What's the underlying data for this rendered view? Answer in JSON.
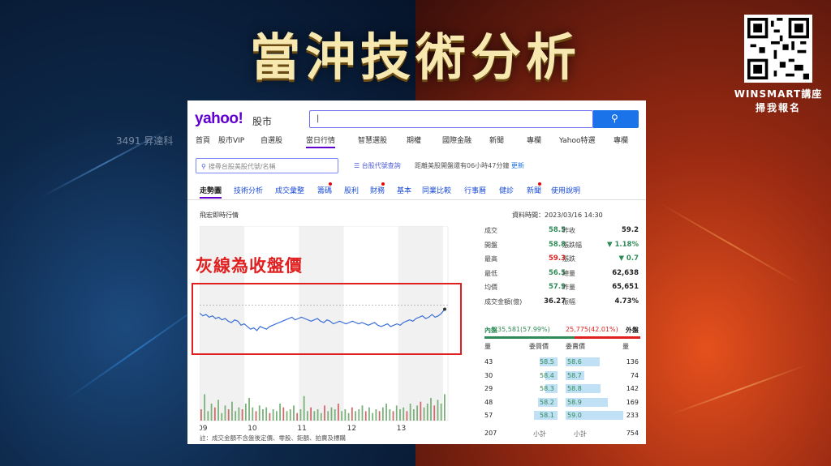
{
  "headline": "當沖技術分析",
  "qr_caption": {
    "line1": "WINSMART講座",
    "line2": "掃我報名"
  },
  "behind_text": "3491 昇達科",
  "annotation": "灰線為收盤價",
  "yahoo": {
    "logo": "yahoo!",
    "logo_sub": "股市",
    "search_button_icon": "search-icon",
    "nav": [
      "首頁",
      "股市VIP",
      "自選股",
      "當日行情",
      "智慧選股",
      "期權",
      "國際金融",
      "新聞",
      "專欄",
      "Yahoo特選",
      "專欄"
    ],
    "nav_active_index": 3,
    "filter_placeholder": "搜尋台股美股代號/名稱",
    "tool_link": "台股代號查詢",
    "market_notice": "距離美股開盤還有06小時47分鐘",
    "market_update": "更新",
    "subtabs": [
      "走勢圖",
      "技術分析",
      "成交彙整",
      "籌碼",
      "股利",
      "財務",
      "基本",
      "同業比較",
      "行事曆",
      "健診",
      "新聞",
      "使用說明"
    ],
    "subtab_active_index": 0,
    "subtab_dots": [
      3,
      5,
      10
    ],
    "section_label": "飛宏即時行情",
    "timestamp": "資料時間：2023/03/16 14:30"
  },
  "chart_data": {
    "type": "line",
    "x_ticks": [
      "09",
      "10",
      "11",
      "12",
      "13"
    ],
    "y_ticks": [
      "65.10",
      "63.92",
      "62.74",
      "61.56",
      "60.38",
      "59.20",
      "58.02",
      "56.84",
      "55.66",
      "54.48",
      "53.30"
    ],
    "current_price_label": "59.20",
    "reference_price": 59.2,
    "ylim": [
      53.3,
      65.1
    ],
    "line_color": "#3a6fd8",
    "price_series": [
      58.6,
      58.4,
      58.5,
      58.3,
      58.4,
      58.2,
      58.3,
      58.1,
      58.2,
      58.0,
      57.9,
      58.1,
      58.0,
      57.7,
      57.8,
      57.6,
      57.4,
      57.5,
      57.3,
      57.6,
      57.5,
      57.4,
      57.6,
      57.7,
      57.8,
      57.9,
      58.0,
      58.1,
      58.2,
      58.3,
      58.1,
      58.2,
      58.3,
      58.2,
      58.1,
      58.0,
      58.1,
      58.2,
      58.0,
      57.9,
      58.1,
      58.0,
      57.8,
      57.9,
      58.0,
      57.9,
      57.8,
      57.9,
      58.0,
      57.9,
      57.8,
      57.9,
      57.8,
      57.7,
      57.8,
      57.9,
      57.7,
      57.6,
      57.7,
      57.8,
      57.6,
      57.7,
      57.8,
      57.7,
      57.9,
      58.0,
      58.1,
      58.0,
      58.2,
      58.3,
      58.4,
      58.2,
      58.3,
      58.5,
      58.3,
      58.4,
      58.6,
      58.9
    ],
    "volume_series": [
      6,
      14,
      5,
      9,
      7,
      11,
      4,
      8,
      6,
      10,
      5,
      7,
      6,
      9,
      12,
      7,
      5,
      8,
      6,
      7,
      4,
      6,
      5,
      9,
      7,
      5,
      6,
      8,
      4,
      6,
      13,
      5,
      7,
      5,
      6,
      4,
      8,
      5,
      7,
      6,
      9,
      5,
      6,
      4,
      7,
      5,
      6,
      8,
      5,
      7,
      4,
      6,
      5,
      7,
      9,
      6,
      5,
      8,
      6,
      7,
      5,
      9,
      6,
      8,
      10,
      7,
      9,
      12,
      8,
      11,
      9,
      14
    ],
    "volume_color": "#7bb27b"
  },
  "stats": [
    {
      "l1": "成交",
      "v1": "58.5",
      "c1": "#2e8b57",
      "l2": "昨收",
      "v2": "59.2",
      "c2": "#222"
    },
    {
      "l1": "開盤",
      "v1": "58.8",
      "c1": "#2e8b57",
      "l2": "漲跌幅",
      "v2": "▼ 1.18%",
      "c2": "#2e8b57"
    },
    {
      "l1": "最高",
      "v1": "59.3",
      "c1": "#e0201f",
      "l2": "漲跌",
      "v2": "▼ 0.7",
      "c2": "#2e8b57"
    },
    {
      "l1": "最低",
      "v1": "56.5",
      "c1": "#2e8b57",
      "l2": "總量",
      "v2": "62,638",
      "c2": "#222"
    },
    {
      "l1": "均價",
      "v1": "57.9",
      "c1": "#2e8b57",
      "l2": "昨量",
      "v2": "65,651",
      "c2": "#222"
    },
    {
      "l1": "成交金額(億)",
      "v1": "36.27",
      "c1": "#222",
      "l2": "振幅",
      "v2": "4.73%",
      "c2": "#222"
    }
  ],
  "order_book": {
    "inner_label": "內盤",
    "inner_value": "35,581(57.99%)",
    "outer_value": "25,775(42.01%)",
    "outer_label": "外盤",
    "inner_ratio": 0.5799,
    "headers": [
      "量",
      "委買價",
      "委賣價",
      "量"
    ],
    "rows": [
      {
        "bq": "43",
        "bp": "58.5",
        "ap": "58.6",
        "aq": "136",
        "bfill": 0.55,
        "afill": 0.55
      },
      {
        "bq": "30",
        "bp": "58.4",
        "ap": "58.7",
        "aq": "74",
        "bfill": 0.38,
        "afill": 0.3
      },
      {
        "bq": "29",
        "bp": "58.3",
        "ap": "58.8",
        "aq": "142",
        "bfill": 0.37,
        "afill": 0.57
      },
      {
        "bq": "48",
        "bp": "58.2",
        "ap": "58.9",
        "aq": "169",
        "bfill": 0.6,
        "afill": 0.68
      },
      {
        "bq": "57",
        "bp": "58.1",
        "ap": "59.0",
        "aq": "233",
        "bfill": 0.72,
        "afill": 0.94
      }
    ],
    "total_bid": "207",
    "total_bid_label": "小計",
    "total_ask_label": "小計",
    "total_ask": "754"
  },
  "footnote": "註：成交金額不含盤後定價、零股、鉅額、拍賣及標購"
}
